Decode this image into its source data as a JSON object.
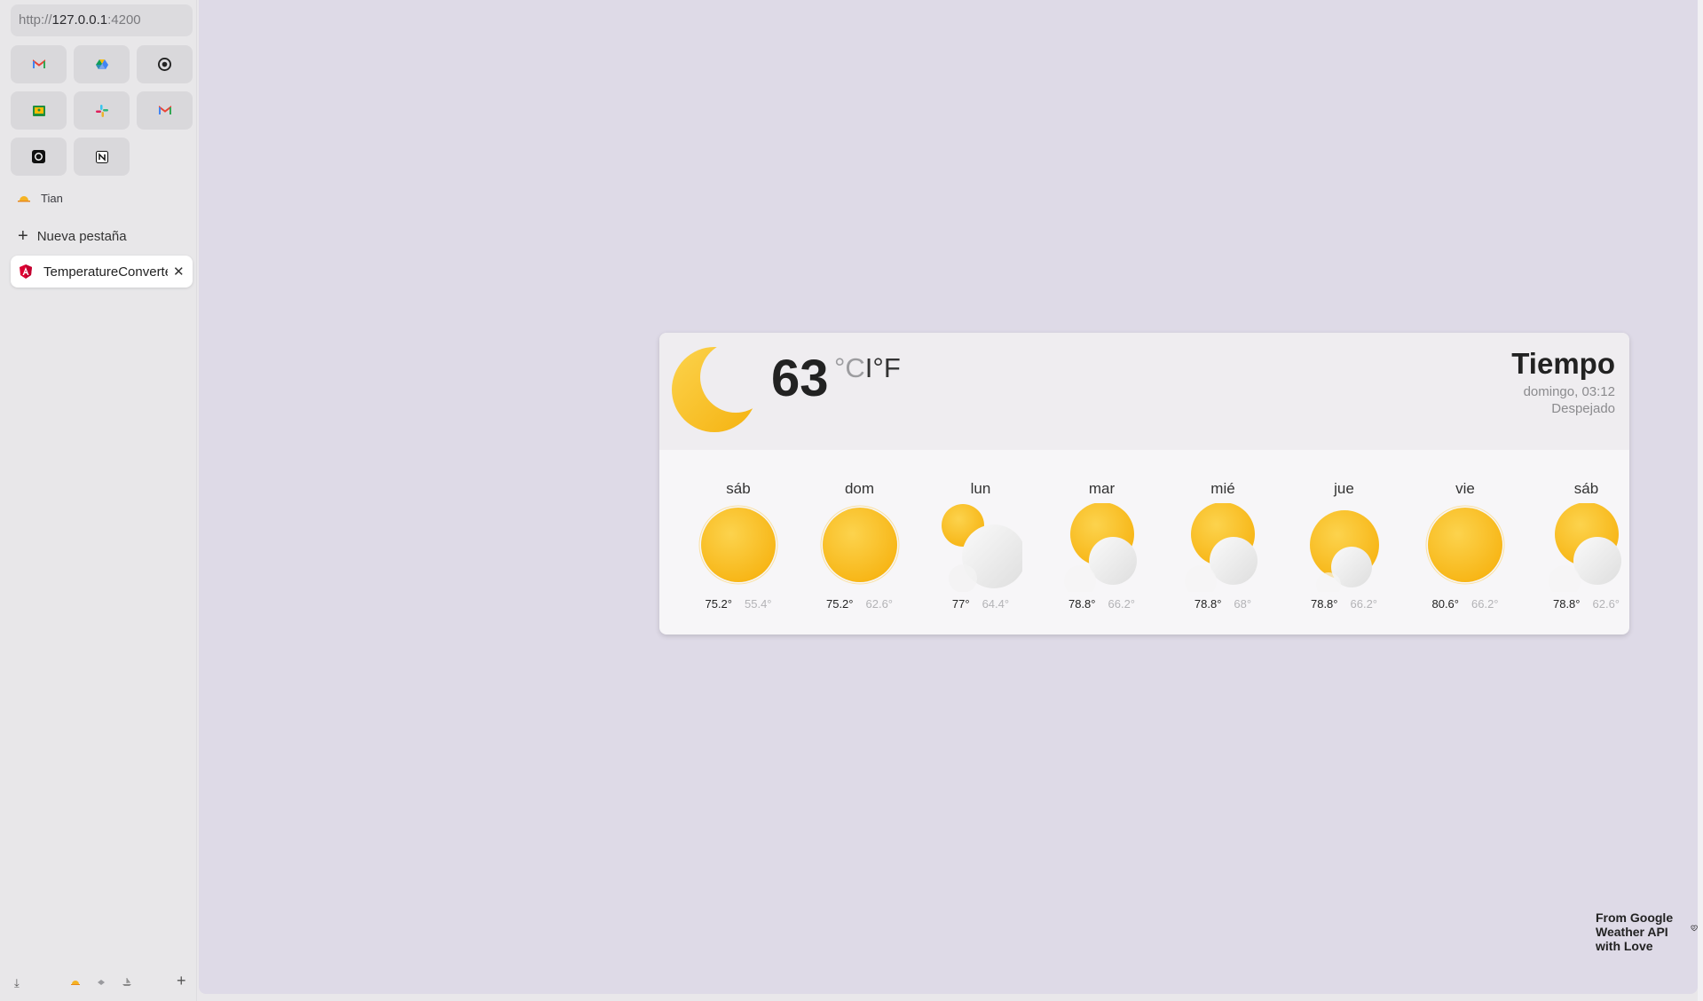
{
  "browser": {
    "url_scheme": "http://",
    "url_host": "127.0.0.1",
    "url_port": ":4200",
    "pinned": [
      {
        "icon": "gmail-icon"
      },
      {
        "icon": "google-drive-icon"
      },
      {
        "icon": "github-icon"
      },
      {
        "icon": "google-classroom-icon"
      },
      {
        "icon": "slack-icon"
      },
      {
        "icon": "gmail-icon"
      },
      {
        "icon": "openai-icon"
      },
      {
        "icon": "notion-icon"
      }
    ],
    "space_name": "Tian",
    "new_tab_label": "Nueva pestaña",
    "active_tab_title": "TemperatureConverter"
  },
  "weather": {
    "current_temp": "63",
    "unit_c": "°C",
    "unit_sep": "I",
    "unit_f": "°F",
    "title": "Tiempo",
    "datetime": "domingo, 03:12",
    "condition": "Despejado",
    "forecast": [
      {
        "day": "sáb",
        "hi": "75.2°",
        "lo": "55.4°",
        "icon": "sunny"
      },
      {
        "day": "dom",
        "hi": "75.2°",
        "lo": "62.6°",
        "icon": "sunny"
      },
      {
        "day": "lun",
        "hi": "77°",
        "lo": "64.4°",
        "icon": "cloudy"
      },
      {
        "day": "mar",
        "hi": "78.8°",
        "lo": "66.2°",
        "icon": "partly-cloudy"
      },
      {
        "day": "mié",
        "hi": "78.8°",
        "lo": "68°",
        "icon": "partly-cloudy"
      },
      {
        "day": "jue",
        "hi": "78.8°",
        "lo": "66.2°",
        "icon": "partly-cloudy-low"
      },
      {
        "day": "vie",
        "hi": "80.6°",
        "lo": "66.2°",
        "icon": "sunny"
      },
      {
        "day": "sáb",
        "hi": "78.8°",
        "lo": "62.6°",
        "icon": "partly-cloudy"
      }
    ],
    "footer": "From Google Weather API with Love"
  },
  "colors": {
    "sun": "#fbc531",
    "background": "#dedae7"
  }
}
